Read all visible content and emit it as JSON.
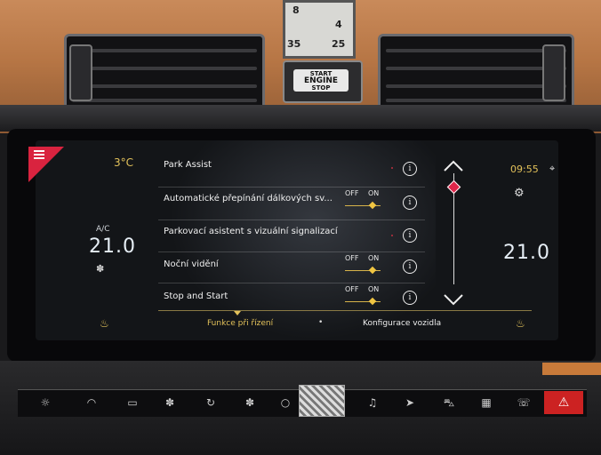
{
  "climate": {
    "outside_temp": "3°C",
    "ac_label": "A/C",
    "driver_temp": "21.0",
    "passenger_temp": "21.0"
  },
  "status": {
    "clock": "09:55"
  },
  "settings_list": {
    "items": [
      {
        "label": "Park Assist",
        "has_toggle": false
      },
      {
        "label": "Automatické přepínání dálkových sv...",
        "has_toggle": true,
        "off": "OFF",
        "on": "ON",
        "state": "on"
      },
      {
        "label": "Parkovací asistent s vizuální signalizací",
        "has_toggle": false
      },
      {
        "label": "Noční vidění",
        "has_toggle": true,
        "off": "OFF",
        "on": "ON",
        "state": "on"
      },
      {
        "label": "Stop and Start",
        "has_toggle": true,
        "off": "OFF",
        "on": "ON",
        "state": "on"
      }
    ],
    "info_symbol": "i"
  },
  "bottom_tabs": {
    "left": "Funkce při řízení",
    "separator": "•",
    "right": "Konfigurace vozidla",
    "active": "left"
  },
  "dashboard": {
    "engine_button": [
      "START",
      "ENGINE",
      "STOP"
    ],
    "clock_dial": [
      "8",
      "4",
      "35",
      "25"
    ]
  },
  "colors": {
    "accent_red": "#d9233f",
    "accent_gold": "#e2c15a",
    "screen_bg": "#131518"
  },
  "icons": {
    "menu": "menu-icon",
    "fan": "fan-icon",
    "seat_heat": "seat-heat-icon",
    "info": "info-icon",
    "scroll_up": "chevron-up-icon",
    "scroll_down": "chevron-down-icon",
    "settings": "gear-icon",
    "location": "location-icon"
  }
}
